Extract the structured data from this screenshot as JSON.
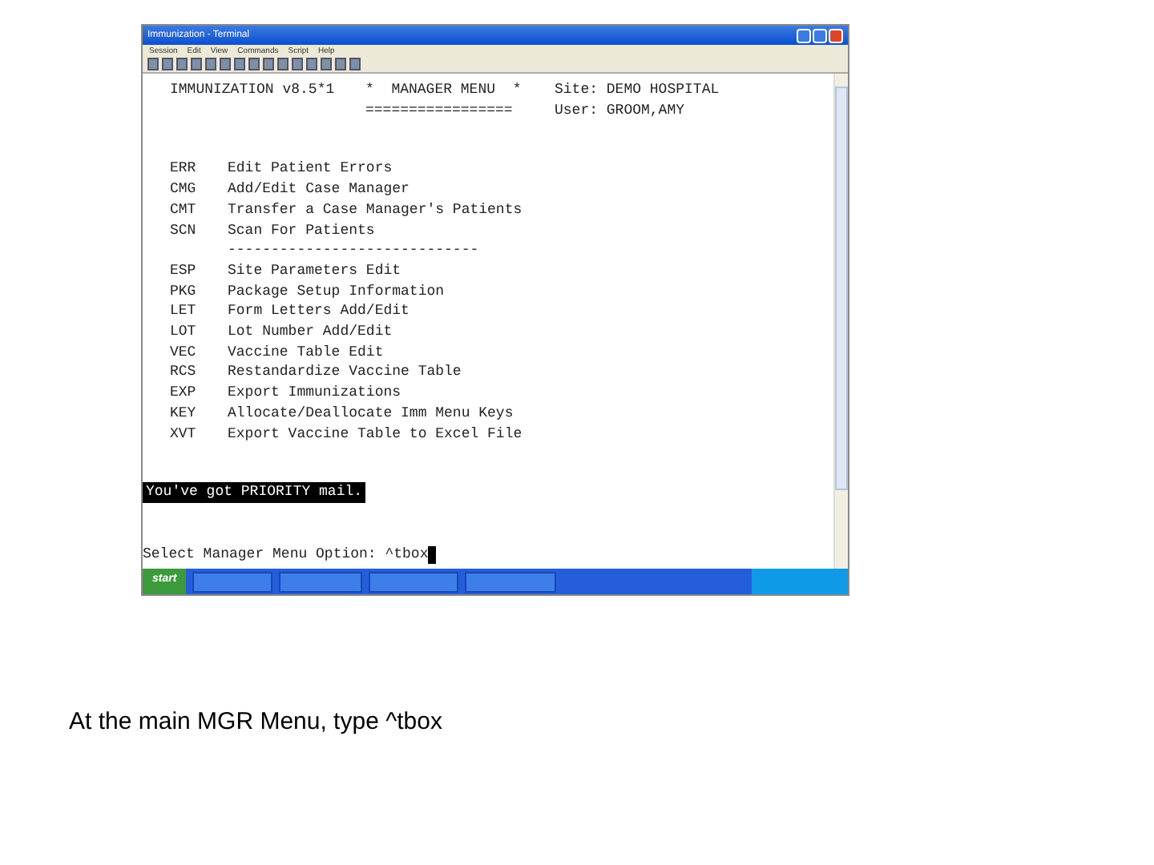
{
  "window": {
    "title": "Immunization - Terminal"
  },
  "menu_bar": [
    "Session",
    "Edit",
    "View",
    "Commands",
    "Script",
    "Help"
  ],
  "terminal": {
    "header": [
      {
        "left": "IMMUNIZATION v8.5*1",
        "center": "*  MANAGER MENU  *",
        "right": "Site: DEMO HOSPITAL"
      },
      {
        "center": "=================",
        "right": "User: GROOM,AMY"
      }
    ],
    "lines": [
      {
        "kind": "item",
        "code": "ERR",
        "label": "Edit Patient Errors"
      },
      {
        "kind": "item",
        "code": "CMG",
        "label": "Add/Edit Case Manager"
      },
      {
        "kind": "item",
        "code": "CMT",
        "label": "Transfer a Case Manager's Patients"
      },
      {
        "kind": "item",
        "code": "SCN",
        "label": "Scan For Patients"
      },
      {
        "kind": "separator",
        "label": "-----------------------------"
      },
      {
        "kind": "item",
        "code": "ESP",
        "label": "Site Parameters Edit"
      },
      {
        "kind": "item",
        "code": "PKG",
        "label": "Package Setup Information"
      },
      {
        "kind": "item",
        "code": "LET",
        "label": "Form Letters Add/Edit"
      },
      {
        "kind": "item",
        "code": "LOT",
        "label": "Lot Number Add/Edit"
      },
      {
        "kind": "item",
        "code": "VEC",
        "label": "Vaccine Table Edit"
      },
      {
        "kind": "item",
        "code": "RCS",
        "label": "Restandardize Vaccine Table"
      },
      {
        "kind": "item",
        "code": "EXP",
        "label": "Export Immunizations"
      },
      {
        "kind": "item",
        "code": "KEY",
        "label": "Allocate/Deallocate Imm Menu Keys"
      },
      {
        "kind": "item",
        "code": "XVT",
        "label": "Export Vaccine Table to Excel File"
      }
    ],
    "notice": "You've got PRIORITY mail.",
    "prompt": "Select Manager Menu Option: ",
    "input": "^tbox"
  },
  "taskbar": {
    "start": "start"
  },
  "caption": "At the main MGR Menu, type ^tbox"
}
